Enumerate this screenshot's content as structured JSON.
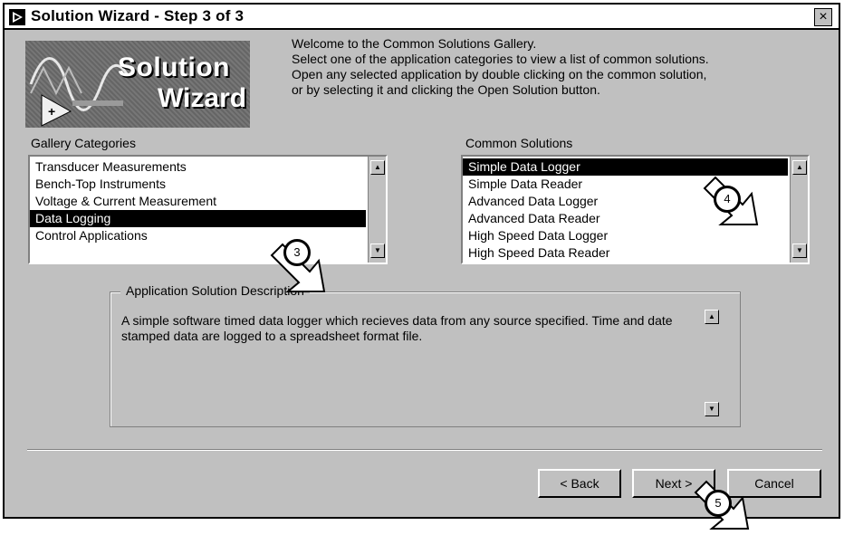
{
  "window": {
    "title": "Solution Wizard - Step 3 of 3",
    "close_glyph": "×"
  },
  "logo": {
    "line1": "Solution",
    "line2": "Wizard"
  },
  "welcome": {
    "lines": [
      "Welcome to the Common Solutions Gallery.",
      "Select one of the application categories to view a list of common solutions.",
      "Open any selected application by double clicking on the common solution,",
      "or by selecting it and clicking the Open Solution button."
    ]
  },
  "gallery": {
    "label": "Gallery Categories",
    "items": [
      "Transducer Measurements",
      "Bench-Top Instruments",
      "Voltage & Current Measurement",
      "Data Logging",
      "Control Applications"
    ],
    "selected": "Data Logging"
  },
  "solutions": {
    "label": "Common Solutions",
    "items": [
      "Simple Data Logger",
      "Simple Data Reader",
      "Advanced Data Logger",
      "Advanced Data Reader",
      "High Speed Data Logger",
      "High Speed Data Reader"
    ],
    "selected": "Simple Data Logger"
  },
  "description": {
    "label": "Application Solution Description",
    "text": "A simple software timed data logger which recieves data from any source specified.  Time and date stamped data are logged to a spreadsheet format file."
  },
  "buttons": {
    "back": "< Back",
    "next": "Next >",
    "cancel": "Cancel"
  },
  "callouts": [
    "3",
    "4",
    "5"
  ],
  "colors": {
    "dialog": "#c0c0c0",
    "selection": "#000000",
    "selection_text": "#ffffff"
  }
}
